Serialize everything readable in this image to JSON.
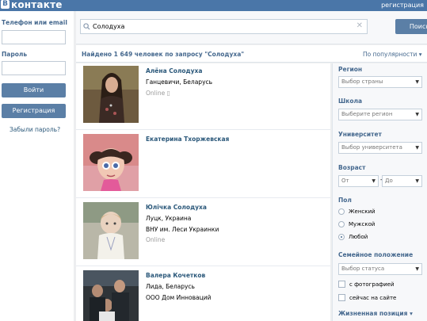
{
  "topbar": {
    "logo_letter": "В",
    "logo_text": "контакте",
    "register_link": "регистрация"
  },
  "login": {
    "phone_label": "Телефон или email",
    "password_label": "Пароль",
    "login_button": "Войти",
    "register_button": "Регистрация",
    "forgot_link": "Забыли пароль?"
  },
  "search": {
    "query": "Солодуха",
    "button": "Поиск",
    "icon": "search-icon",
    "clear_icon": "close-icon"
  },
  "results_header": {
    "found_text": "Найдено 1 649 человек по запросу \"Солодуха\"",
    "sort_label": "По популярности"
  },
  "results": [
    {
      "name": "Алёна Солодуха",
      "line2": "Ганцевичи, Беларусь",
      "line3": "Online ▯",
      "line4": ""
    },
    {
      "name": "Екатерина Тхоржевская",
      "line2": "",
      "line3": "",
      "line4": ""
    },
    {
      "name": "Юлічка Солодуха",
      "line2": "Луцк, Украина",
      "line3": "ВНУ им. Леси Украинки",
      "line4": "Online"
    },
    {
      "name": "Валера Кочетков",
      "line2": "Лида, Беларусь",
      "line3": "ООО Дом Инноваций",
      "line4": ""
    }
  ],
  "filters": {
    "region_label": "Регион",
    "region_value": "Выбор страны",
    "school_label": "Школа",
    "school_value": "Выберите регион",
    "university_label": "Университет",
    "university_value": "Выбор университета",
    "age_label": "Возраст",
    "age_from": "От",
    "age_dash": "-",
    "age_to": "До",
    "sex_label": "Пол",
    "sex_options": [
      "Женский",
      "Мужской",
      "Любой"
    ],
    "sex_selected": "Любой",
    "marital_label": "Семейное положение",
    "marital_value": "Выбор статуса",
    "with_photo": "с фотографией",
    "online_now": "сейчас на сайте",
    "life_position": "Жизненная позиция ▾"
  },
  "colors": {
    "brand": "#4a76a8",
    "link": "#2b587a",
    "button": "#5b7fa6",
    "header_text": "#45688e"
  }
}
